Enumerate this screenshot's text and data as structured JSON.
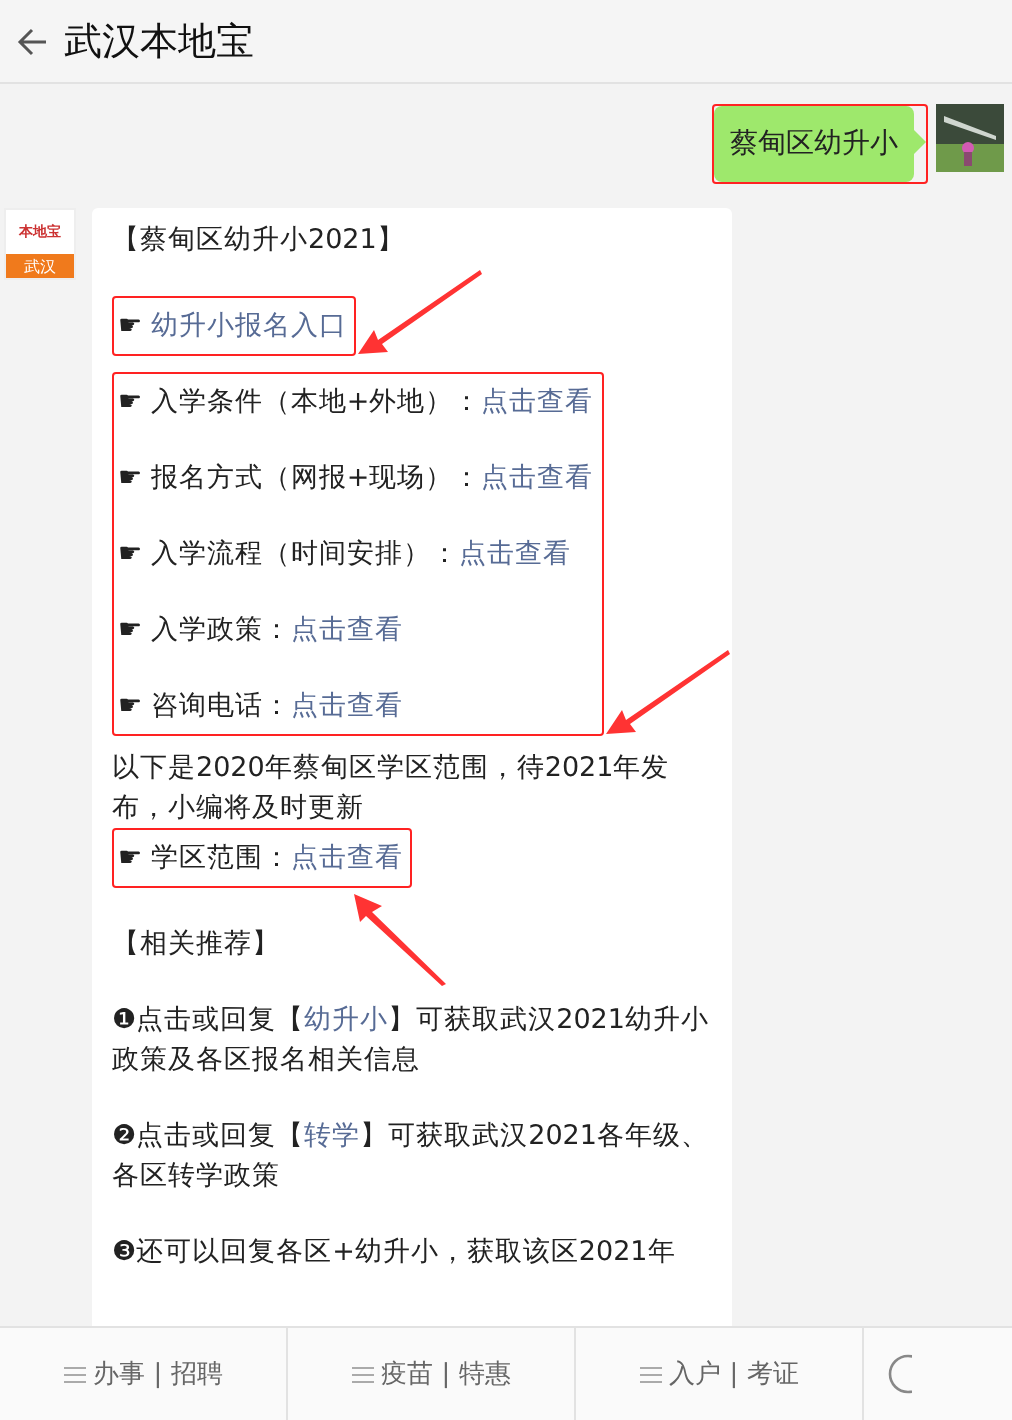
{
  "header": {
    "title": "武汉本地宝"
  },
  "outgoing": {
    "text": "蔡甸区幼升小",
    "highlighted": true
  },
  "sender": {
    "logo_top": "本地宝",
    "logo_bottom": "武汉"
  },
  "blocks": [
    {
      "kind": "heading",
      "text": "【蔡甸区幼升小2021】"
    },
    {
      "kind": "group",
      "highlighted": true,
      "arrow": {
        "kind": "right"
      },
      "items": [
        {
          "mark": "☛",
          "link": "幼升小报名入口"
        }
      ]
    },
    {
      "kind": "group",
      "highlighted": true,
      "arrow": {
        "kind": "right"
      },
      "items": [
        {
          "mark": "☛",
          "label": "入学条件（本地+外地）：",
          "link": "点击查看"
        },
        {
          "mark": "☛",
          "label": "报名方式（网报+现场）：",
          "link": "点击查看"
        },
        {
          "mark": "☛",
          "label": "入学流程（时间安排）：",
          "link": "点击查看"
        },
        {
          "mark": "☛",
          "label": "入学政策：",
          "link": "点击查看"
        },
        {
          "mark": "☛",
          "label": "咨询电话：",
          "link": "点击查看"
        }
      ]
    },
    {
      "kind": "paragraph",
      "text": "以下是2020年蔡甸区学区范围，待2021年发布，小编将及时更新"
    },
    {
      "kind": "group",
      "highlighted": true,
      "arrow": {
        "kind": "below"
      },
      "items": [
        {
          "mark": "☛",
          "label": "学区范围：",
          "link": "点击查看"
        }
      ]
    },
    {
      "kind": "heading",
      "text": "【相关推荐】"
    },
    {
      "kind": "rec",
      "bullet": "❶",
      "before": "点击或回复【",
      "link": "幼升小",
      "after": "】可获取武汉2021幼升小政策及各区报名相关信息"
    },
    {
      "kind": "rec",
      "bullet": "❷",
      "before": "点击或回复【",
      "link": "转学",
      "after": "】可获取武汉2021各年级、各区转学政策"
    },
    {
      "kind": "rec",
      "bullet": "❸",
      "before": "还可以回复各区+幼升小，获取该区2021年"
    }
  ],
  "menu": [
    {
      "label": "办事 | 招聘"
    },
    {
      "label": "疫苗 | 特惠"
    },
    {
      "label": "入户 | 考证"
    }
  ]
}
